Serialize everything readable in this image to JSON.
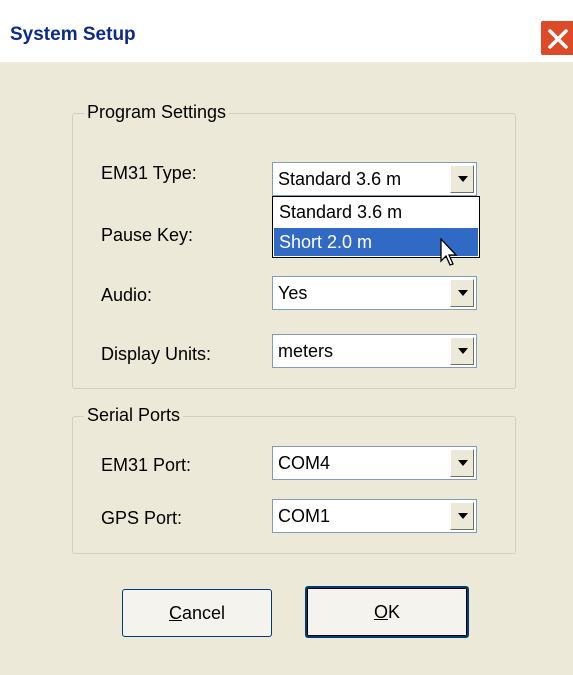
{
  "window": {
    "title": "System Setup"
  },
  "program_settings": {
    "legend": "Program Settings",
    "fields": [
      {
        "label": "EM31 Type:",
        "value": "Standard 3.6 m"
      },
      {
        "label": "Pause Key:",
        "value": ""
      },
      {
        "label": "Audio:",
        "value": "Yes"
      },
      {
        "label": "Display Units:",
        "value": "meters"
      }
    ],
    "em31_type_options": [
      "Standard 3.6 m",
      "Short 2.0 m"
    ],
    "highlighted_option": "Short 2.0 m"
  },
  "serial_ports": {
    "legend": "Serial Ports",
    "fields": [
      {
        "label": "EM31 Port:",
        "value": "COM4"
      },
      {
        "label": "GPS Port:",
        "value": "COM1"
      }
    ]
  },
  "buttons": {
    "cancel_mnemonic": "C",
    "cancel_rest": "ancel",
    "ok_mnemonic": "O",
    "ok_rest": "K"
  },
  "icons": {
    "close": "close-icon",
    "dropdown_arrow": "chevron-down-icon",
    "cursor": "mouse-pointer-icon"
  },
  "colors": {
    "close_button": "#dd4a28",
    "title_text": "#0b2a8a",
    "dialog_face": "#ece9d8",
    "selection": "#316ac5"
  }
}
